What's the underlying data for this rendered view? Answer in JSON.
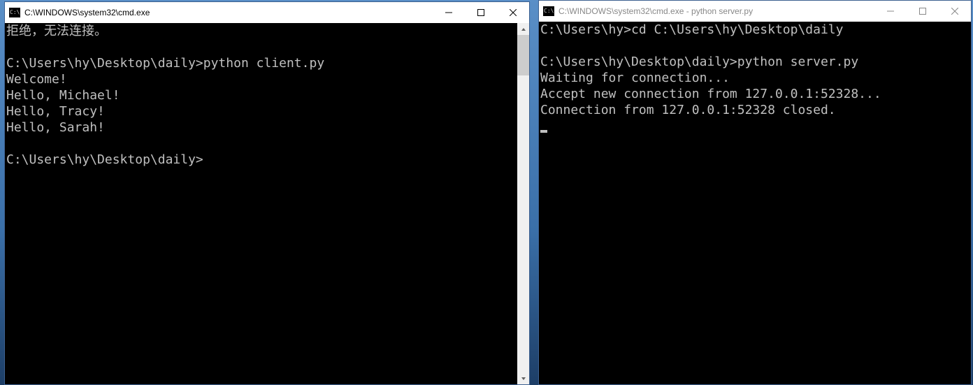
{
  "windows": {
    "left": {
      "title": "C:\\WINDOWS\\system32\\cmd.exe",
      "icon_text": "C:\\",
      "active": true,
      "content": "拒绝，无法连接。\n\nC:\\Users\\hy\\Desktop\\daily>python client.py\nWelcome!\nHello, Michael!\nHello, Tracy!\nHello, Sarah!\n\nC:\\Users\\hy\\Desktop\\daily>",
      "scrollbar": {
        "thumb_top_pct": 0,
        "thumb_height_pct": 12
      }
    },
    "right": {
      "title": "C:\\WINDOWS\\system32\\cmd.exe - python  server.py",
      "icon_text": "C:\\",
      "active": false,
      "content": "C:\\Users\\hy>cd C:\\Users\\hy\\Desktop\\daily\n\nC:\\Users\\hy\\Desktop\\daily>python server.py\nWaiting for connection...\nAccept new connection from 127.0.0.1:52328...\nConnection from 127.0.0.1:52328 closed.",
      "cursor": true
    }
  },
  "controls": {
    "minimize": "minimize",
    "maximize": "maximize",
    "close": "close"
  }
}
